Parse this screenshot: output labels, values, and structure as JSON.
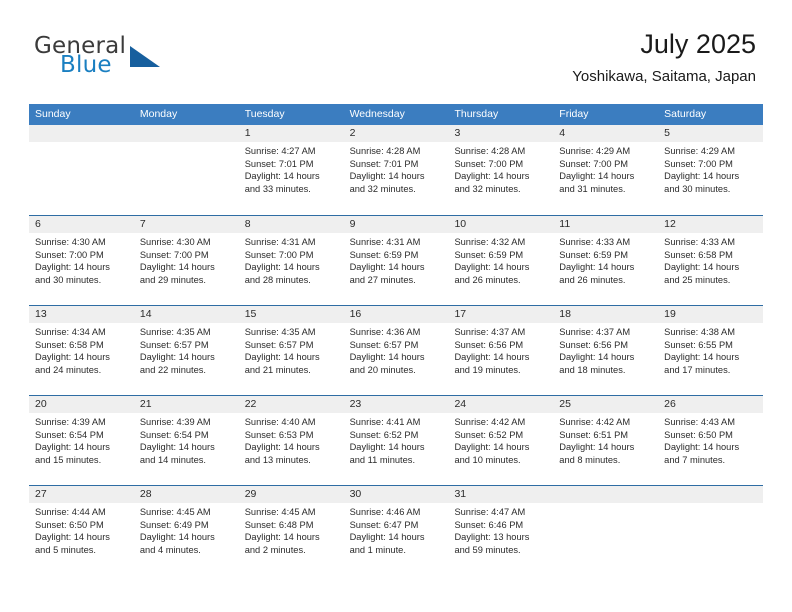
{
  "brand": {
    "name_part1": "General",
    "name_part2": "Blue",
    "triangle_icon": "triangle-logo-icon",
    "accent_color": "#175f9e"
  },
  "header": {
    "title": "July 2025",
    "location": "Yoshikawa, Saitama, Japan"
  },
  "colors": {
    "header_row_blue": "#3b7dc0",
    "row_divider_blue": "#2e6da4",
    "day_band_gray": "#efefef",
    "brand_blue": "#1a7fc1"
  },
  "calendar": {
    "weekday_headers": [
      "Sunday",
      "Monday",
      "Tuesday",
      "Wednesday",
      "Thursday",
      "Friday",
      "Saturday"
    ],
    "weeks": [
      [
        {
          "day": "",
          "lines": []
        },
        {
          "day": "",
          "lines": []
        },
        {
          "day": "1",
          "lines": [
            "Sunrise: 4:27 AM",
            "Sunset: 7:01 PM",
            "Daylight: 14 hours",
            "and 33 minutes."
          ]
        },
        {
          "day": "2",
          "lines": [
            "Sunrise: 4:28 AM",
            "Sunset: 7:01 PM",
            "Daylight: 14 hours",
            "and 32 minutes."
          ]
        },
        {
          "day": "3",
          "lines": [
            "Sunrise: 4:28 AM",
            "Sunset: 7:00 PM",
            "Daylight: 14 hours",
            "and 32 minutes."
          ]
        },
        {
          "day": "4",
          "lines": [
            "Sunrise: 4:29 AM",
            "Sunset: 7:00 PM",
            "Daylight: 14 hours",
            "and 31 minutes."
          ]
        },
        {
          "day": "5",
          "lines": [
            "Sunrise: 4:29 AM",
            "Sunset: 7:00 PM",
            "Daylight: 14 hours",
            "and 30 minutes."
          ]
        }
      ],
      [
        {
          "day": "6",
          "lines": [
            "Sunrise: 4:30 AM",
            "Sunset: 7:00 PM",
            "Daylight: 14 hours",
            "and 30 minutes."
          ]
        },
        {
          "day": "7",
          "lines": [
            "Sunrise: 4:30 AM",
            "Sunset: 7:00 PM",
            "Daylight: 14 hours",
            "and 29 minutes."
          ]
        },
        {
          "day": "8",
          "lines": [
            "Sunrise: 4:31 AM",
            "Sunset: 7:00 PM",
            "Daylight: 14 hours",
            "and 28 minutes."
          ]
        },
        {
          "day": "9",
          "lines": [
            "Sunrise: 4:31 AM",
            "Sunset: 6:59 PM",
            "Daylight: 14 hours",
            "and 27 minutes."
          ]
        },
        {
          "day": "10",
          "lines": [
            "Sunrise: 4:32 AM",
            "Sunset: 6:59 PM",
            "Daylight: 14 hours",
            "and 26 minutes."
          ]
        },
        {
          "day": "11",
          "lines": [
            "Sunrise: 4:33 AM",
            "Sunset: 6:59 PM",
            "Daylight: 14 hours",
            "and 26 minutes."
          ]
        },
        {
          "day": "12",
          "lines": [
            "Sunrise: 4:33 AM",
            "Sunset: 6:58 PM",
            "Daylight: 14 hours",
            "and 25 minutes."
          ]
        }
      ],
      [
        {
          "day": "13",
          "lines": [
            "Sunrise: 4:34 AM",
            "Sunset: 6:58 PM",
            "Daylight: 14 hours",
            "and 24 minutes."
          ]
        },
        {
          "day": "14",
          "lines": [
            "Sunrise: 4:35 AM",
            "Sunset: 6:57 PM",
            "Daylight: 14 hours",
            "and 22 minutes."
          ]
        },
        {
          "day": "15",
          "lines": [
            "Sunrise: 4:35 AM",
            "Sunset: 6:57 PM",
            "Daylight: 14 hours",
            "and 21 minutes."
          ]
        },
        {
          "day": "16",
          "lines": [
            "Sunrise: 4:36 AM",
            "Sunset: 6:57 PM",
            "Daylight: 14 hours",
            "and 20 minutes."
          ]
        },
        {
          "day": "17",
          "lines": [
            "Sunrise: 4:37 AM",
            "Sunset: 6:56 PM",
            "Daylight: 14 hours",
            "and 19 minutes."
          ]
        },
        {
          "day": "18",
          "lines": [
            "Sunrise: 4:37 AM",
            "Sunset: 6:56 PM",
            "Daylight: 14 hours",
            "and 18 minutes."
          ]
        },
        {
          "day": "19",
          "lines": [
            "Sunrise: 4:38 AM",
            "Sunset: 6:55 PM",
            "Daylight: 14 hours",
            "and 17 minutes."
          ]
        }
      ],
      [
        {
          "day": "20",
          "lines": [
            "Sunrise: 4:39 AM",
            "Sunset: 6:54 PM",
            "Daylight: 14 hours",
            "and 15 minutes."
          ]
        },
        {
          "day": "21",
          "lines": [
            "Sunrise: 4:39 AM",
            "Sunset: 6:54 PM",
            "Daylight: 14 hours",
            "and 14 minutes."
          ]
        },
        {
          "day": "22",
          "lines": [
            "Sunrise: 4:40 AM",
            "Sunset: 6:53 PM",
            "Daylight: 14 hours",
            "and 13 minutes."
          ]
        },
        {
          "day": "23",
          "lines": [
            "Sunrise: 4:41 AM",
            "Sunset: 6:52 PM",
            "Daylight: 14 hours",
            "and 11 minutes."
          ]
        },
        {
          "day": "24",
          "lines": [
            "Sunrise: 4:42 AM",
            "Sunset: 6:52 PM",
            "Daylight: 14 hours",
            "and 10 minutes."
          ]
        },
        {
          "day": "25",
          "lines": [
            "Sunrise: 4:42 AM",
            "Sunset: 6:51 PM",
            "Daylight: 14 hours",
            "and 8 minutes."
          ]
        },
        {
          "day": "26",
          "lines": [
            "Sunrise: 4:43 AM",
            "Sunset: 6:50 PM",
            "Daylight: 14 hours",
            "and 7 minutes."
          ]
        }
      ],
      [
        {
          "day": "27",
          "lines": [
            "Sunrise: 4:44 AM",
            "Sunset: 6:50 PM",
            "Daylight: 14 hours",
            "and 5 minutes."
          ]
        },
        {
          "day": "28",
          "lines": [
            "Sunrise: 4:45 AM",
            "Sunset: 6:49 PM",
            "Daylight: 14 hours",
            "and 4 minutes."
          ]
        },
        {
          "day": "29",
          "lines": [
            "Sunrise: 4:45 AM",
            "Sunset: 6:48 PM",
            "Daylight: 14 hours",
            "and 2 minutes."
          ]
        },
        {
          "day": "30",
          "lines": [
            "Sunrise: 4:46 AM",
            "Sunset: 6:47 PM",
            "Daylight: 14 hours",
            "and 1 minute."
          ]
        },
        {
          "day": "31",
          "lines": [
            "Sunrise: 4:47 AM",
            "Sunset: 6:46 PM",
            "Daylight: 13 hours",
            "and 59 minutes."
          ]
        },
        {
          "day": "",
          "lines": []
        },
        {
          "day": "",
          "lines": []
        }
      ]
    ]
  }
}
